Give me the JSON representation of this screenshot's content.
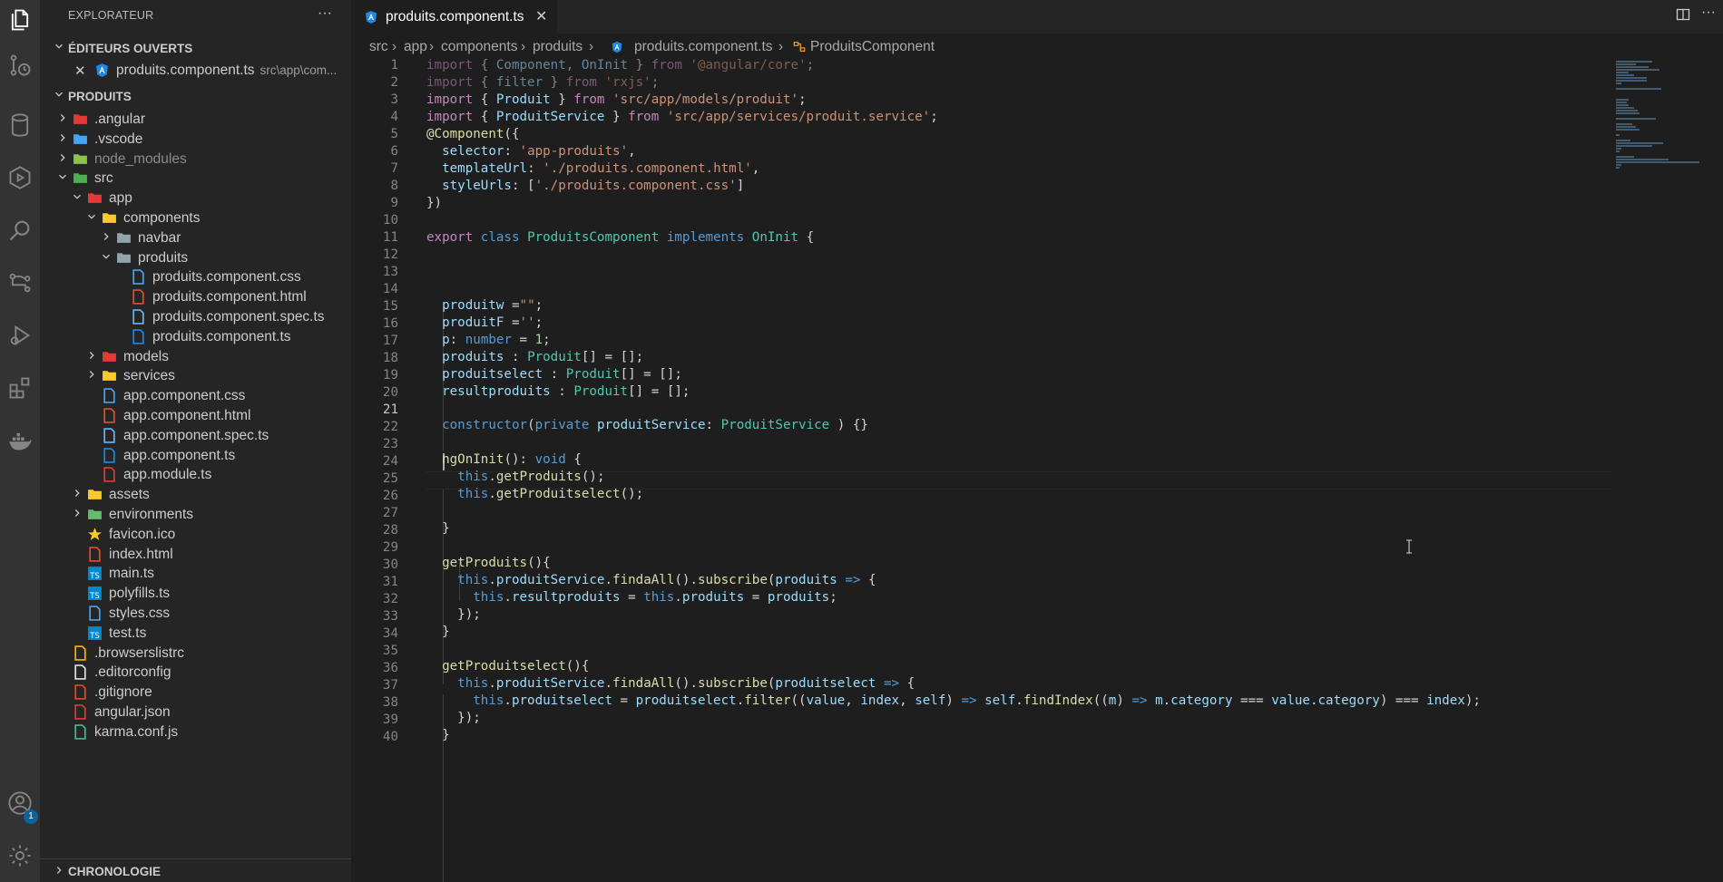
{
  "activity_bar": {
    "icons": [
      "files-icon",
      "source-control-icon",
      "database-icon",
      "run-debug-icon",
      "search-icon",
      "git-graph-icon",
      "debug-icon",
      "extensions-icon",
      "docker-icon",
      "account-icon",
      "settings-gear-icon"
    ],
    "account_badge": "1"
  },
  "sidebar": {
    "title": "EXPLORATEUR",
    "more": "···",
    "open_editors_header": "ÉDITEURS OUVERTS",
    "open_editor": {
      "name": "produits.component.ts",
      "path": "src\\app\\com..."
    },
    "project_header": "PRODUITS",
    "tree": [
      {
        "label": ".angular",
        "icon": "angular-folder-icon"
      },
      {
        "label": ".vscode",
        "icon": "vscode-folder-icon"
      },
      {
        "label": "node_modules",
        "icon": "node-folder-icon"
      },
      {
        "label": "src",
        "icon": "src-folder-icon"
      },
      {
        "label": "app",
        "icon": "app-folder-icon"
      },
      {
        "label": "components",
        "icon": "components-folder-icon"
      },
      {
        "label": "navbar",
        "icon": "folder-icon"
      },
      {
        "label": "produits",
        "icon": "folder-open-icon"
      },
      {
        "label": "produits.component.css",
        "icon": "css-file-icon"
      },
      {
        "label": "produits.component.html",
        "icon": "html-file-icon"
      },
      {
        "label": "produits.component.spec.ts",
        "icon": "test-file-icon"
      },
      {
        "label": "produits.component.ts",
        "icon": "angular-component-icon"
      },
      {
        "label": "models",
        "icon": "models-folder-icon"
      },
      {
        "label": "services",
        "icon": "services-folder-icon"
      },
      {
        "label": "app.component.css",
        "icon": "css-file-icon"
      },
      {
        "label": "app.component.html",
        "icon": "html-file-icon"
      },
      {
        "label": "app.component.spec.ts",
        "icon": "test-file-icon"
      },
      {
        "label": "app.component.ts",
        "icon": "angular-component-icon"
      },
      {
        "label": "app.module.ts",
        "icon": "angular-module-icon"
      },
      {
        "label": "assets",
        "icon": "assets-folder-icon"
      },
      {
        "label": "environments",
        "icon": "environment-folder-icon"
      },
      {
        "label": "favicon.ico",
        "icon": "favicon-star-icon"
      },
      {
        "label": "index.html",
        "icon": "html-file-icon"
      },
      {
        "label": "main.ts",
        "icon": "ts-file-icon"
      },
      {
        "label": "polyfills.ts",
        "icon": "ts-file-icon"
      },
      {
        "label": "styles.css",
        "icon": "css-file-icon"
      },
      {
        "label": "test.ts",
        "icon": "ts-file-icon"
      },
      {
        "label": ".browserslistrc",
        "icon": "browserslist-icon"
      },
      {
        "label": ".editorconfig",
        "icon": "editorconfig-icon"
      },
      {
        "label": ".gitignore",
        "icon": "git-file-icon"
      },
      {
        "label": "angular.json",
        "icon": "angular-json-icon"
      },
      {
        "label": "karma.conf.js",
        "icon": "karma-icon"
      }
    ],
    "chrono_header": "CHRONOLOGIE"
  },
  "tab": {
    "label": "produits.component.ts",
    "close": "✕"
  },
  "tabbar_actions": {
    "split": "split-editor-icon",
    "more": "···"
  },
  "breadcrumb": {
    "parts": [
      "src",
      "app",
      "components",
      "produits",
      "produits.component.ts",
      "ProduitsComponent"
    ],
    "separator": "›"
  },
  "editor": {
    "current_line": 21,
    "line_numbers": [
      "1",
      "2",
      "3",
      "4",
      "5",
      "6",
      "7",
      "8",
      "9",
      "10",
      "11",
      "12",
      "13",
      "14",
      "15",
      "16",
      "17",
      "18",
      "19",
      "20",
      "21",
      "22",
      "23",
      "24",
      "25",
      "26",
      "27",
      "28",
      "29",
      "30",
      "31",
      "32",
      "33",
      "34",
      "35",
      "36",
      "37",
      "38",
      "39",
      "40"
    ]
  }
}
